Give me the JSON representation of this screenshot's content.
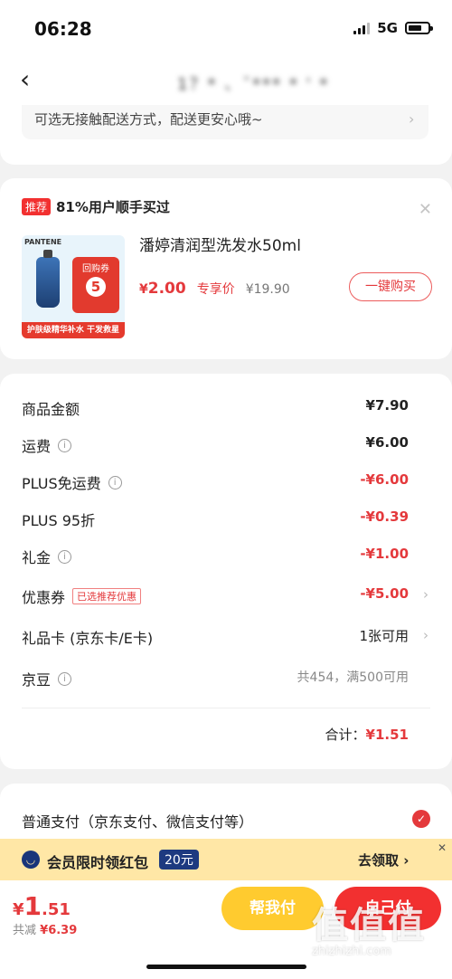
{
  "status_bar": {
    "time": "06:28",
    "network": "5G"
  },
  "nav": {
    "title": "1？* 、ˇ*** * ' *"
  },
  "delivery": {
    "text": "可选无接触配送方式，配送更安心哦~"
  },
  "recommend": {
    "tag": "推荐",
    "headline": "81%用户顺手买过",
    "product_name": "潘婷清润型洗发水50ml",
    "price_currency": "¥",
    "price": "2.00",
    "price_label": "专享价",
    "original_price": "¥19.90",
    "buy_button": "一键购买",
    "thumb_brand": "PANTENE",
    "thumb_coupon_label": "回购券",
    "thumb_coupon_value": "5",
    "thumb_strip": "护肤级精华补水  干发救星"
  },
  "fees": [
    {
      "label": "商品金额",
      "value": "¥7.90"
    },
    {
      "label": "运费",
      "value": "¥6.00"
    },
    {
      "label": "PLUS免运费",
      "value": "-¥6.00"
    },
    {
      "label": "PLUS 95折",
      "value": "-¥0.39"
    },
    {
      "label": "礼金",
      "value": "-¥1.00"
    },
    {
      "label": "优惠券",
      "badge": "已选推荐优惠",
      "value": "-¥5.00"
    },
    {
      "label": "礼品卡 (京东卡/E卡)",
      "value": "1张可用"
    },
    {
      "label": "京豆",
      "value": "共454，满500可用"
    }
  ],
  "total": {
    "label": "合计：",
    "value": "¥1.51"
  },
  "payment": {
    "label": "普通支付（京东支付、微信支付等）"
  },
  "banner": {
    "text": "会员限时领红包",
    "amount": "20元",
    "action": "去领取 ›"
  },
  "bottom": {
    "currency": "¥",
    "price_int": "1",
    "price_dec": ".51",
    "saved_label": "共减",
    "saved_value": "¥6.39",
    "help_pay": "帮我付",
    "self_pay": "自己付"
  },
  "watermark": {
    "title": "值值值",
    "url": "zhizhizhi.com"
  },
  "colors": {
    "accent_red": "#e4393c",
    "banner_yellow": "#ffe7a6",
    "help_yellow": "#ffcb2f"
  }
}
